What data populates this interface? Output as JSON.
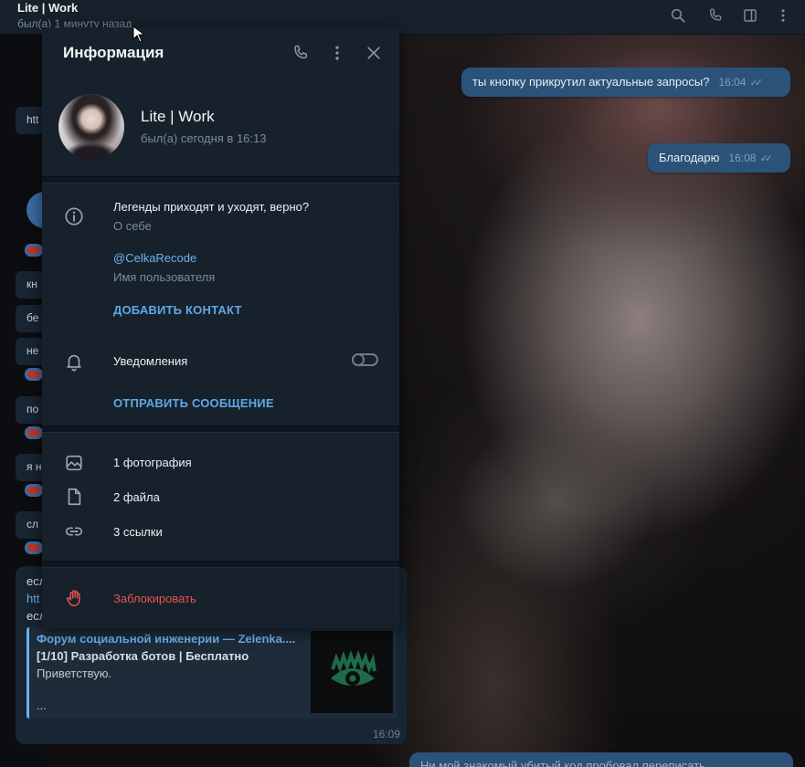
{
  "window": {
    "chat_title": "Lite | Work",
    "chat_status": "был(а) 1 минуту назад",
    "toolbar_icons": [
      "search-icon",
      "phone-icon",
      "sidebar-icon",
      "more-vertical-icon"
    ]
  },
  "chat": {
    "outgoing_messages": [
      {
        "text": "ты кнопку прикрутил актуальные запросы?",
        "time": "16:04"
      },
      {
        "text": "Благодарю",
        "time": "16:08"
      }
    ],
    "left_fragments": [
      "htt",
      "кн",
      "бе",
      "не",
      "по",
      "я н",
      "сл",
      "есл",
      "htt",
      "есл"
    ],
    "link_preview": {
      "site": "Форум социальной инженерии — Zelenka....",
      "title": "[1/10] Разработка ботов | Бесплатно",
      "description": "Приветствую.",
      "ellipsis": "...",
      "time": "16:09"
    },
    "bottom_message": "Ни мой знакомый убитый код пробовал переписать"
  },
  "info_panel": {
    "title": "Информация",
    "header_icons": [
      "phone-icon",
      "more-vertical-icon",
      "close-icon"
    ],
    "profile": {
      "name": "Lite | Work",
      "status": "был(а) сегодня в 16:13"
    },
    "bio": {
      "text": "Легенды приходят и уходят, верно?",
      "label": "О себе"
    },
    "username": {
      "value": "@CelkaRecode",
      "label": "Имя пользователя"
    },
    "add_contact": "ДОБАВИТЬ КОНТАКТ",
    "notifications": {
      "label": "Уведомления",
      "enabled": false
    },
    "send_message": "ОТПРАВИТЬ СООБЩЕНИЕ",
    "media": [
      {
        "icon": "photo-icon",
        "label": "1 фотография"
      },
      {
        "icon": "file-icon",
        "label": "2 файла"
      },
      {
        "icon": "link-icon",
        "label": "3 ссылки"
      }
    ],
    "block": "Заблокировать",
    "colors": {
      "panel_bg": "#17212b",
      "accent": "#6ab2f2",
      "danger": "#e6534e",
      "outgoing_bubble": "#2b5278"
    }
  }
}
